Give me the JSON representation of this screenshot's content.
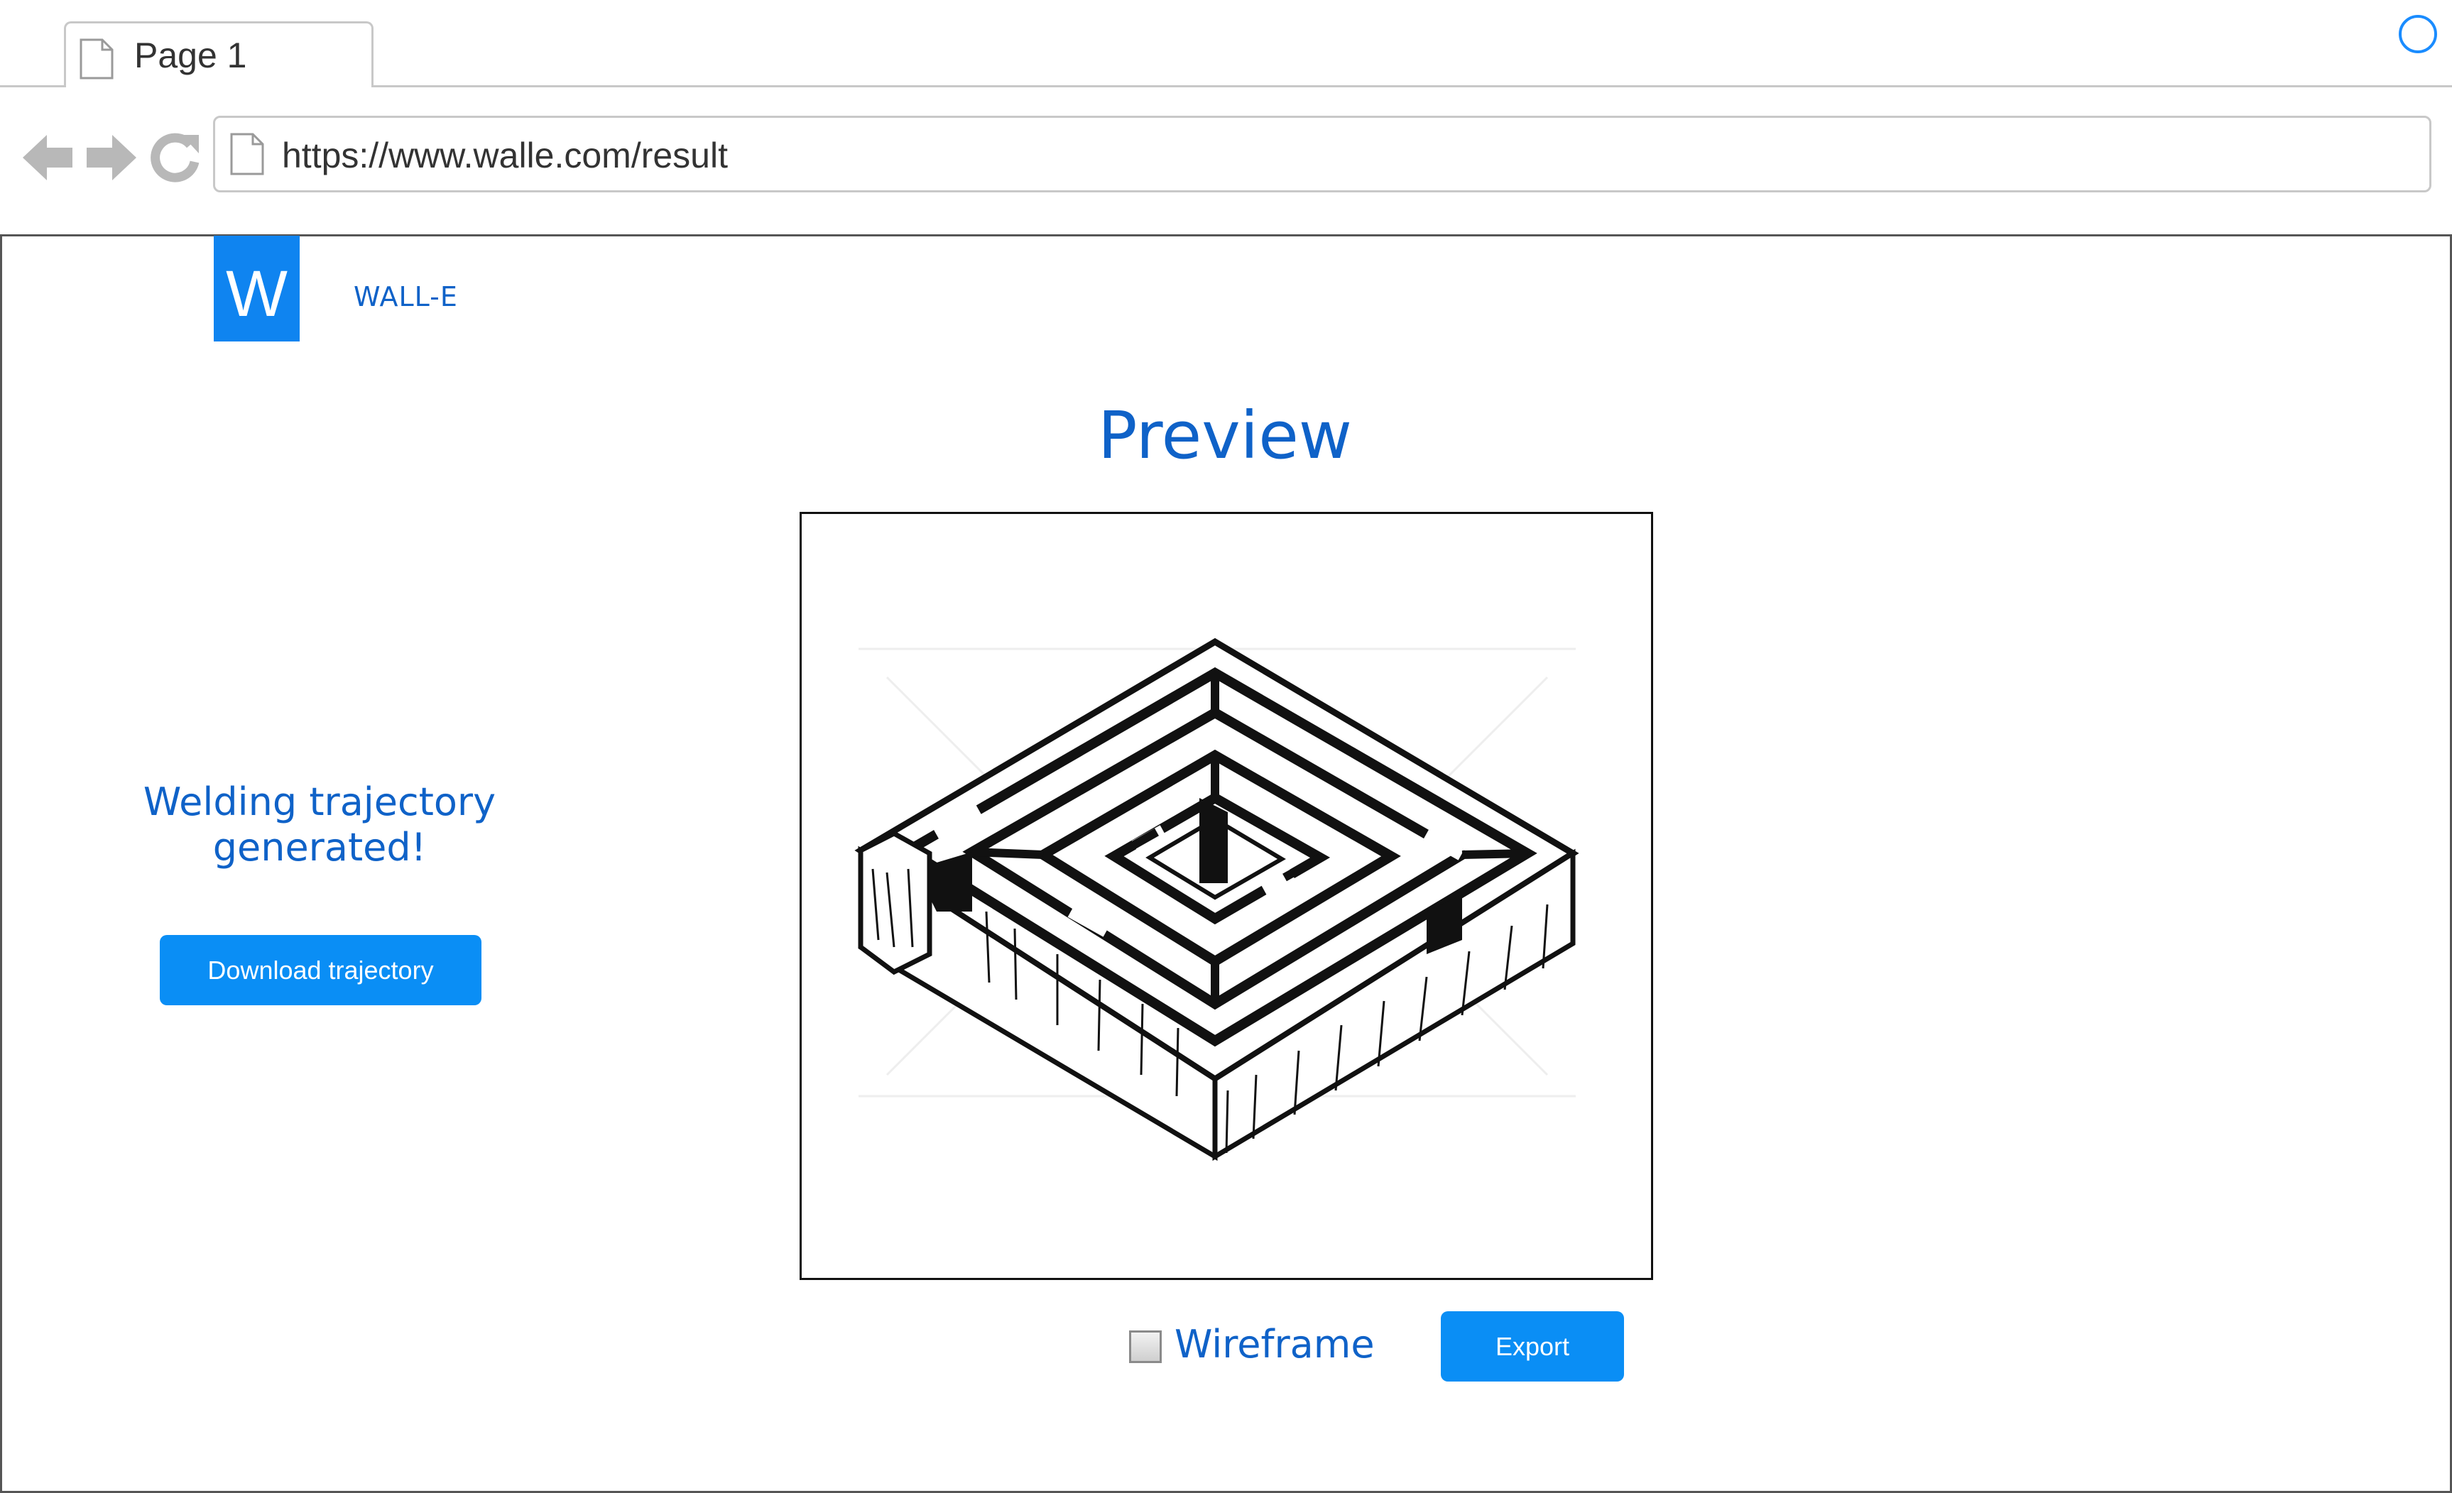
{
  "browser": {
    "tab_title": "Page 1",
    "url": "https://www.walle.com/result"
  },
  "brand": {
    "logo_letter": "W",
    "name": "WALL-E",
    "color": "#0f84f0"
  },
  "main": {
    "title": "Preview",
    "status_message": "Welding trajectory generated!",
    "download_button": "Download trajectory",
    "wireframe_label": "Wireframe",
    "wireframe_checked": false,
    "export_button": "Export"
  },
  "colors": {
    "accent": "#0a8ef5",
    "text_blue": "#0f62c8"
  }
}
